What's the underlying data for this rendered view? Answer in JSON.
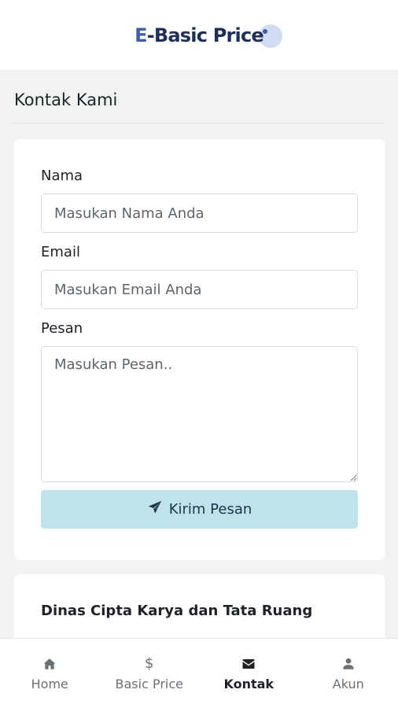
{
  "header": {
    "logo_e": "E",
    "logo_rest": "-Basic Price"
  },
  "page": {
    "title": "Kontak Kami"
  },
  "form": {
    "name_label": "Nama",
    "name_placeholder": "Masukan Nama Anda",
    "email_label": "Email",
    "email_placeholder": "Masukan Email Anda",
    "message_label": "Pesan",
    "message_placeholder": "Masukan Pesan..",
    "submit_label": "Kirim Pesan",
    "submit_icon": "paper-plane-icon"
  },
  "info": {
    "org_name": "Dinas Cipta Karya dan Tata Ruang"
  },
  "nav": {
    "items": [
      {
        "label": "Home",
        "icon": "home-icon",
        "active": false
      },
      {
        "label": "Basic Price",
        "icon": "dollar-icon",
        "symbol": "$",
        "active": false
      },
      {
        "label": "Kontak",
        "icon": "envelope-icon",
        "active": true
      },
      {
        "label": "Akun",
        "icon": "user-icon",
        "active": false
      }
    ]
  },
  "colors": {
    "accent_button": "#c0e2ea",
    "logo_blue": "#3f5fa6",
    "logo_navy": "#1f2f57",
    "page_bg": "#f1f3f3"
  }
}
